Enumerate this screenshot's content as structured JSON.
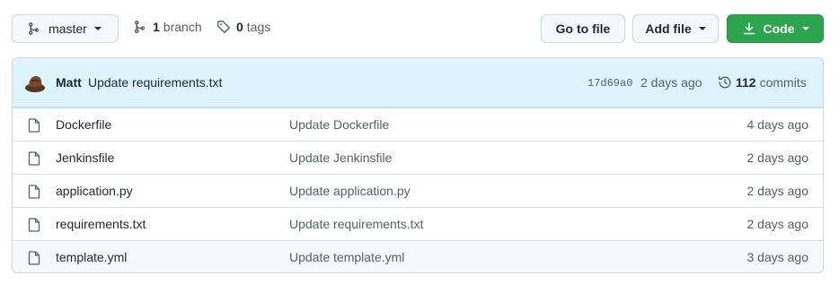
{
  "toolbar": {
    "branch_name": "master",
    "branch_count": "1",
    "branch_label": "branch",
    "tag_count": "0",
    "tag_label": "tags",
    "goto_file_label": "Go to file",
    "add_file_label": "Add file",
    "code_label": "Code"
  },
  "latest_commit": {
    "author": "Matt",
    "message": "Update requirements.txt",
    "sha": "17d69a0",
    "time": "2 days ago",
    "commit_count": "112",
    "commits_label": "commits"
  },
  "files": [
    {
      "name": "Dockerfile",
      "message": "Update Dockerfile",
      "age": "4 days ago"
    },
    {
      "name": "Jenkinsfile",
      "message": "Update Jenkinsfile",
      "age": "2 days ago"
    },
    {
      "name": "application.py",
      "message": "Update application.py",
      "age": "2 days ago"
    },
    {
      "name": "requirements.txt",
      "message": "Update requirements.txt",
      "age": "2 days ago"
    },
    {
      "name": "template.yml",
      "message": "Update template.yml",
      "age": "3 days ago"
    }
  ],
  "colors": {
    "code_button": "#2da44e",
    "header_bg": "#ddf4ff"
  }
}
